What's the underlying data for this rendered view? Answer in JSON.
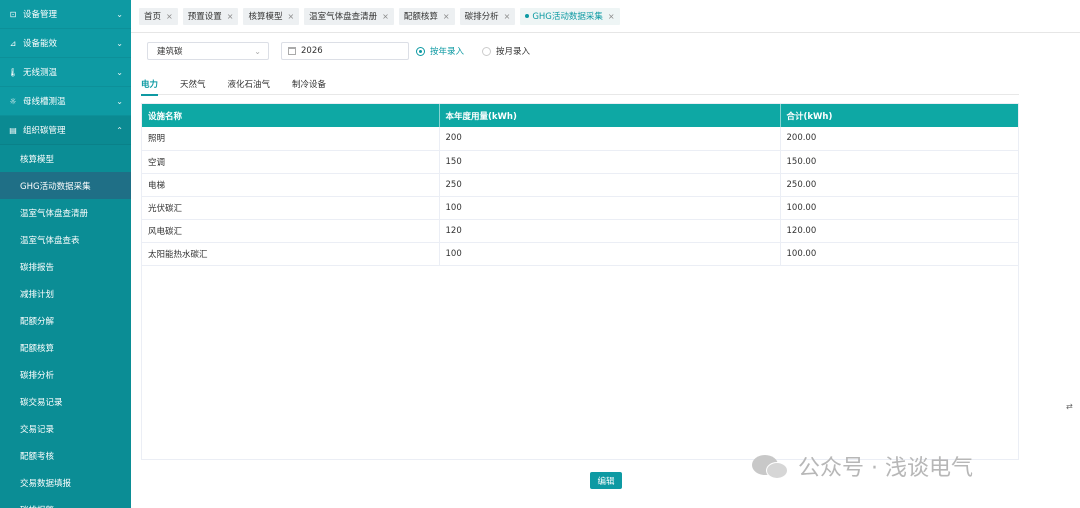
{
  "sidebar": {
    "groups": [
      {
        "label": "设备管理",
        "icon": "device-icon"
      },
      {
        "label": "设备能效",
        "icon": "chart-icon"
      },
      {
        "label": "无线测温",
        "icon": "thermometer-icon"
      },
      {
        "label": "母线槽测温",
        "icon": "sun-icon"
      },
      {
        "label": "组织碳管理",
        "icon": "org-icon"
      }
    ],
    "sub_items": [
      {
        "label": "核算模型"
      },
      {
        "label": "GHG活动数据采集"
      },
      {
        "label": "温室气体盘查清册"
      },
      {
        "label": "温室气体盘查表"
      },
      {
        "label": "碳排报告"
      },
      {
        "label": "减排计划"
      },
      {
        "label": "配额分解"
      },
      {
        "label": "配额核算"
      },
      {
        "label": "碳排分析"
      },
      {
        "label": "碳交易记录"
      },
      {
        "label": "交易记录"
      },
      {
        "label": "配额考核"
      },
      {
        "label": "交易数据填报"
      },
      {
        "label": "碳排报警"
      }
    ]
  },
  "tabs": [
    {
      "label": "首页"
    },
    {
      "label": "预置设置"
    },
    {
      "label": "核算模型"
    },
    {
      "label": "温室气体盘查清册"
    },
    {
      "label": "配额核算"
    },
    {
      "label": "碳排分析"
    },
    {
      "label": "GHG活动数据采集"
    }
  ],
  "filters": {
    "category": "建筑碳",
    "year": "2026",
    "radio_year": "按年录入",
    "radio_month": "按月录入"
  },
  "subtabs": [
    {
      "label": "电力"
    },
    {
      "label": "天然气"
    },
    {
      "label": "液化石油气"
    },
    {
      "label": "制冷设备"
    }
  ],
  "table": {
    "headers": [
      "设施名称",
      "本年度用量(kWh)",
      "合计(kWh)"
    ],
    "rows": [
      [
        "照明",
        "200",
        "200.00"
      ],
      [
        "空调",
        "150",
        "150.00"
      ],
      [
        "电梯",
        "250",
        "250.00"
      ],
      [
        "光伏碳汇",
        "100",
        "100.00"
      ],
      [
        "风电碳汇",
        "120",
        "120.00"
      ],
      [
        "太阳能热水碳汇",
        "100",
        "100.00"
      ]
    ]
  },
  "actions": {
    "edit": "编辑"
  },
  "watermark": {
    "text": "公众号 · 浅谈电气"
  },
  "colors": {
    "accent": "#0e9aa3",
    "header": "#0ea8a4",
    "active_sub": "#1f6f86"
  }
}
